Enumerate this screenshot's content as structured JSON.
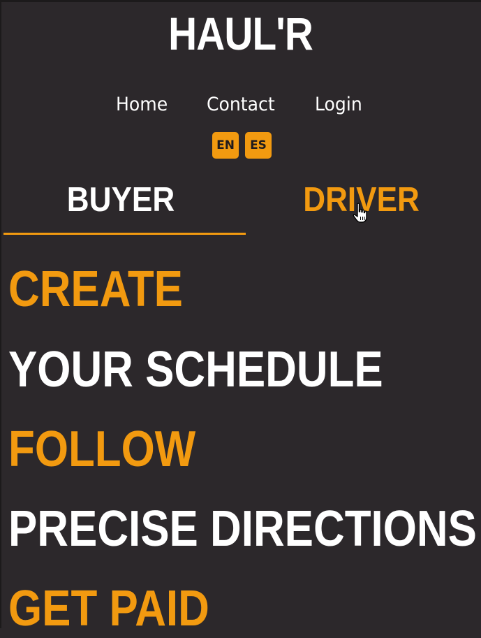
{
  "brand": {
    "logo_text": "HAUL'R"
  },
  "nav": {
    "items": [
      {
        "label": "Home"
      },
      {
        "label": "Contact"
      },
      {
        "label": "Login"
      }
    ]
  },
  "language": {
    "options": [
      {
        "label": "EN"
      },
      {
        "label": "ES"
      }
    ]
  },
  "tabs": {
    "items": [
      {
        "label": "BUYER",
        "active": true
      },
      {
        "label": "DRIVER",
        "active": false
      }
    ]
  },
  "hero": {
    "lines": [
      {
        "text": "CREATE",
        "color": "orange"
      },
      {
        "text": "YOUR SCHEDULE",
        "color": "white"
      },
      {
        "text": "FOLLOW",
        "color": "orange"
      },
      {
        "text": "PRECISE DIRECTIONS",
        "color": "white"
      },
      {
        "text": "GET PAID",
        "color": "orange"
      }
    ]
  },
  "colors": {
    "background": "#2c282b",
    "accent": "#f29a10",
    "text": "#ffffff"
  },
  "icons": {
    "pointer": "hand-pointer-cursor-icon"
  }
}
